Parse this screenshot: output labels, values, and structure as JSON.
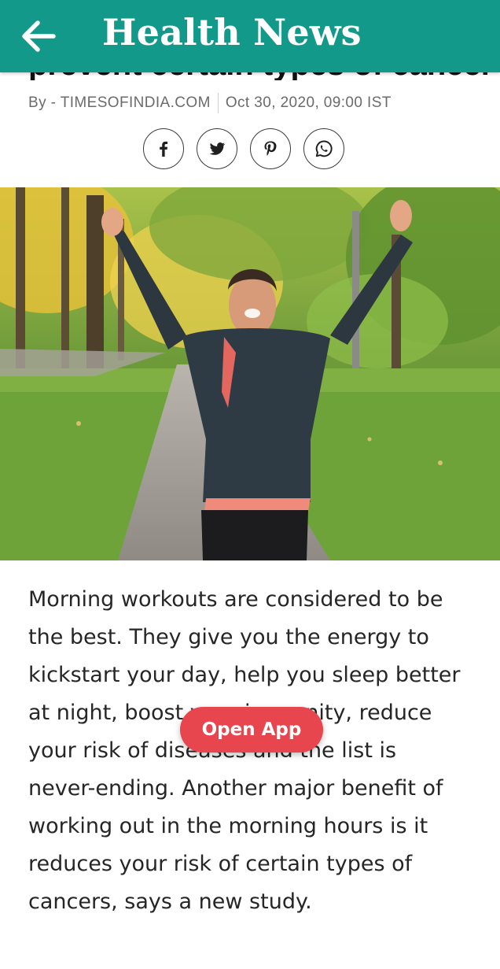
{
  "app_bar": {
    "title": "Health News",
    "back_icon": "arrow-left-icon",
    "background": "#13998a"
  },
  "article": {
    "headline_partial": "prevent certain types of cancer",
    "byline_author": "By - TIMESOFINDIA.COM",
    "byline_date": "Oct 30, 2020, 09:00 IST",
    "body": "Morning workouts are considered to be the best. They give you the energy to kickstart your day, help you sleep better at night, boost your immunity, reduce your risk of diseases and the list is never-ending. Another major benefit of working out in the morning hours is it reduces your risk of certain types of cancers, says a new study."
  },
  "share": [
    {
      "icon": "facebook-icon"
    },
    {
      "icon": "twitter-icon"
    },
    {
      "icon": "pinterest-icon"
    },
    {
      "icon": "whatsapp-icon"
    }
  ],
  "open_app": {
    "label": "Open App",
    "color": "#e8464e"
  }
}
